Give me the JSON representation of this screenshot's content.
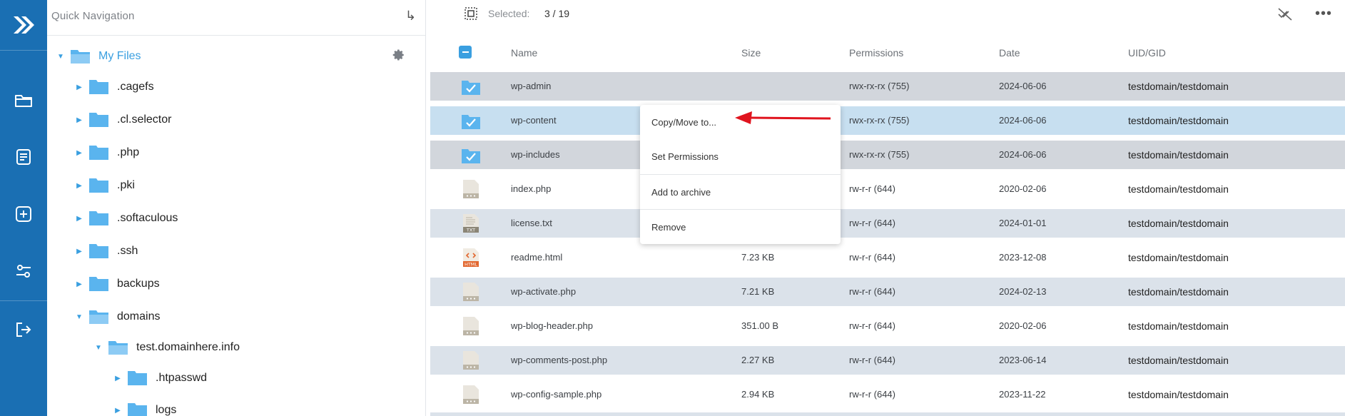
{
  "rail": {
    "items": [
      {
        "name": "logo",
        "icon": "chevrons-right-logo-icon"
      },
      {
        "name": "files",
        "icon": "folder-icon"
      },
      {
        "name": "documents",
        "icon": "document-icon"
      },
      {
        "name": "create",
        "icon": "plus-square-icon"
      },
      {
        "name": "settings",
        "icon": "sliders-icon"
      },
      {
        "name": "logout",
        "icon": "logout-icon"
      }
    ]
  },
  "tree": {
    "quick_navigation": "Quick Navigation",
    "root": "My Files",
    "items": [
      {
        "label": ".cagefs"
      },
      {
        "label": ".cl.selector"
      },
      {
        "label": ".php"
      },
      {
        "label": ".pki"
      },
      {
        "label": ".softaculous"
      },
      {
        "label": ".ssh"
      },
      {
        "label": "backups"
      },
      {
        "label": "domains"
      },
      {
        "label": "test.domainhere.info"
      },
      {
        "label": ".htpasswd"
      },
      {
        "label": "logs"
      }
    ]
  },
  "toolbar": {
    "selected_label": "Selected:",
    "selected_count": "3 / 19"
  },
  "table": {
    "headers": {
      "name": "Name",
      "size": "Size",
      "permissions": "Permissions",
      "date": "Date",
      "uid": "UID/GID"
    },
    "rows": [
      {
        "name": "wp-admin",
        "size": "",
        "permissions": "rwx-rx-rx (755)",
        "date": "2024-06-06",
        "uid": "testdomain/testdomain",
        "type": "folder-checked"
      },
      {
        "name": "wp-content",
        "size": "",
        "permissions": "rwx-rx-rx (755)",
        "date": "2024-06-06",
        "uid": "testdomain/testdomain",
        "type": "folder-checked"
      },
      {
        "name": "wp-includes",
        "size": "",
        "permissions": "rwx-rx-rx (755)",
        "date": "2024-06-06",
        "uid": "testdomain/testdomain",
        "type": "folder-checked"
      },
      {
        "name": "index.php",
        "size": "",
        "permissions": "rw-r-r (644)",
        "date": "2020-02-06",
        "uid": "testdomain/testdomain",
        "type": "file"
      },
      {
        "name": "license.txt",
        "size": "",
        "permissions": "rw-r-r (644)",
        "date": "2024-01-01",
        "uid": "testdomain/testdomain",
        "type": "txt"
      },
      {
        "name": "readme.html",
        "size": "7.23 KB",
        "permissions": "rw-r-r (644)",
        "date": "2023-12-08",
        "uid": "testdomain/testdomain",
        "type": "html"
      },
      {
        "name": "wp-activate.php",
        "size": "7.21 KB",
        "permissions": "rw-r-r (644)",
        "date": "2024-02-13",
        "uid": "testdomain/testdomain",
        "type": "file"
      },
      {
        "name": "wp-blog-header.php",
        "size": "351.00 B",
        "permissions": "rw-r-r (644)",
        "date": "2020-02-06",
        "uid": "testdomain/testdomain",
        "type": "file"
      },
      {
        "name": "wp-comments-post.php",
        "size": "2.27 KB",
        "permissions": "rw-r-r (644)",
        "date": "2023-06-14",
        "uid": "testdomain/testdomain",
        "type": "file"
      },
      {
        "name": "wp-config-sample.php",
        "size": "2.94 KB",
        "permissions": "rw-r-r (644)",
        "date": "2023-11-22",
        "uid": "testdomain/testdomain",
        "type": "file"
      }
    ]
  },
  "context_menu": {
    "items": [
      "Copy/Move to...",
      "Set Permissions",
      "Add to archive",
      "Remove"
    ]
  },
  "file_badges": {
    "txt": "TXT",
    "html": "HTML"
  },
  "colors": {
    "accent": "#1a6fb3",
    "folder": "#5ab4ee",
    "arrow": "#e0141e"
  }
}
